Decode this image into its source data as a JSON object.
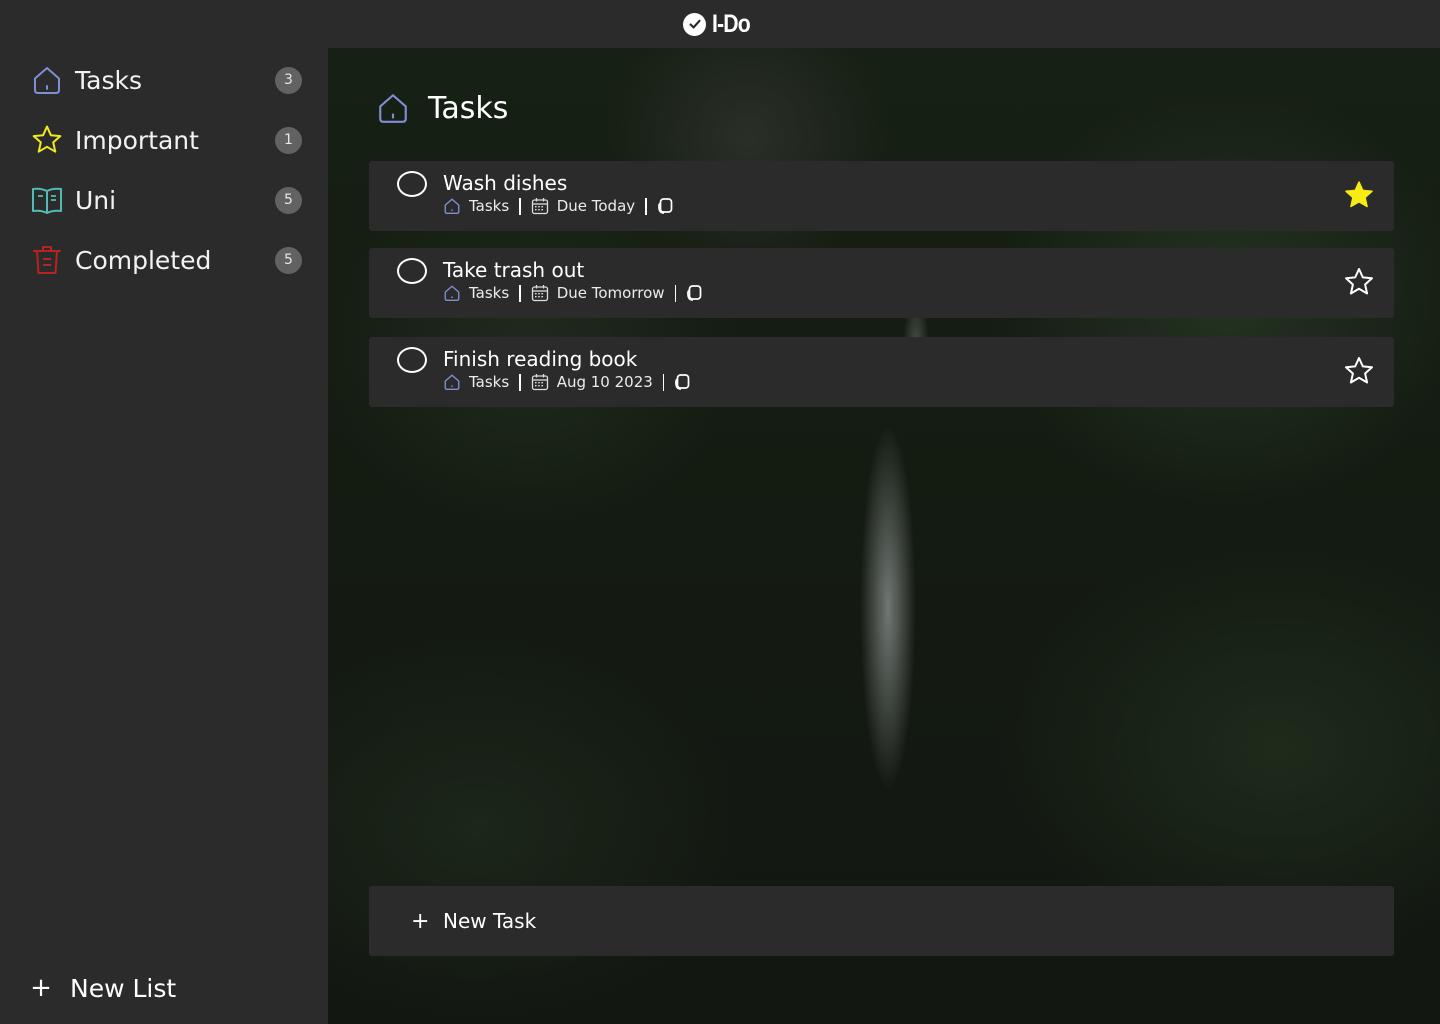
{
  "app": {
    "title": "I-Do"
  },
  "sidebar": {
    "items": [
      {
        "label": "Tasks",
        "count": "3",
        "icon": "home-icon",
        "color": "#7f8fd4"
      },
      {
        "label": "Important",
        "count": "1",
        "icon": "star-icon",
        "color": "#f1ea1f"
      },
      {
        "label": "Uni",
        "count": "5",
        "icon": "book-icon",
        "color": "#4fbdb4"
      },
      {
        "label": "Completed",
        "count": "5",
        "icon": "trash-icon",
        "color": "#b52323"
      }
    ],
    "new_list_label": "New List"
  },
  "main": {
    "title": "Tasks",
    "tasks": [
      {
        "name": "Wash dishes",
        "list": "Tasks",
        "due": "Due Today",
        "important": true
      },
      {
        "name": "Take trash out",
        "list": "Tasks",
        "due": "Due Tomorrow",
        "important": false
      },
      {
        "name": "Finish reading book",
        "list": "Tasks",
        "due": "Aug 10 2023",
        "important": false
      }
    ],
    "new_task_label": "New Task"
  },
  "colors": {
    "background": "#2b2b2b",
    "star_active": "#f6ec14",
    "badge": "#626262"
  }
}
